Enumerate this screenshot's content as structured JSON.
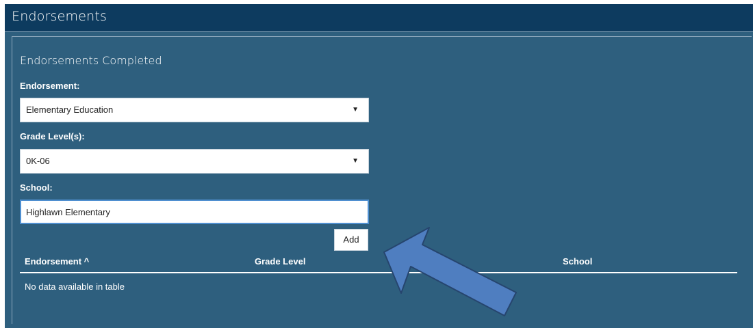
{
  "panel": {
    "title": "Endorsements"
  },
  "section": {
    "title": "Endorsements Completed"
  },
  "form": {
    "endorsement_label": "Endorsement:",
    "endorsement_value": "Elementary Education",
    "grade_label": "Grade Level(s):",
    "grade_value": "0K-06",
    "school_label": "School:",
    "school_value": "Highlawn Elementary",
    "add_label": "Add"
  },
  "table": {
    "columns": [
      "Endorsement ^",
      "Grade Level",
      "School"
    ],
    "empty_message": "No data available in table"
  },
  "icons": {
    "dropdown": "caret-down-icon",
    "sort": "sort-asc-icon",
    "pointer": "callout-arrow"
  },
  "colors": {
    "panel_bg": "#2e5f7e",
    "header_bg": "#0d3b5f",
    "arrow_fill": "#4f7ec0",
    "arrow_stroke": "#26456e"
  }
}
